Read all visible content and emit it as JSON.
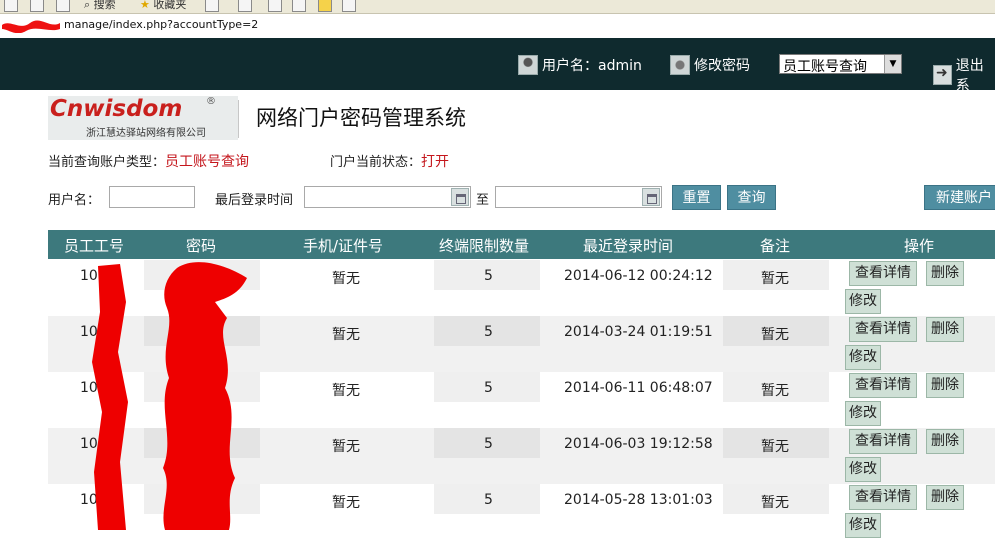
{
  "browser": {
    "toolbar": {
      "search_label": "搜索",
      "favorites_label": "收藏夹"
    },
    "address_url": "manage/index.php?accountType=2"
  },
  "header": {
    "username_label": "用户名：admin",
    "change_password_label": "修改密码",
    "account_select_value": "员工账号查询",
    "logout_label": "退出系"
  },
  "logo": {
    "brand": "Cnwisdom",
    "reg_mark": "®",
    "company": "浙江慧达驿站网络有限公司"
  },
  "page_title": "网络门户密码管理系统",
  "status": {
    "query_type_label": "当前查询账户类型：",
    "query_type_value": "员工账号查询",
    "portal_state_label": "门户当前状态：",
    "portal_state_value": "打开"
  },
  "search": {
    "username_label": "用户名：",
    "last_login_label": "最后登录时间",
    "to_label": "至",
    "reset_button": "重置",
    "query_button": "查询",
    "new_account_button": "新建账户"
  },
  "table": {
    "columns": [
      "员工工号",
      "密码",
      "手机/证件号",
      "终端限制数量",
      "最近登录时间",
      "备注",
      "操作"
    ],
    "detail_button": "查看详情",
    "delete_button": "删除",
    "edit_button": "修改",
    "rows": [
      {
        "id": "10",
        "phone": "暂无",
        "limit": "5",
        "last_login": "2014-06-12 00:24:12",
        "note": "暂无"
      },
      {
        "id": "10",
        "phone": "暂无",
        "limit": "5",
        "last_login": "2014-03-24 01:19:51",
        "note": "暂无"
      },
      {
        "id": "10",
        "phone": "暂无",
        "limit": "5",
        "last_login": "2014-06-11 06:48:07",
        "note": "暂无"
      },
      {
        "id": "10",
        "phone": "暂无",
        "limit": "5",
        "last_login": "2014-06-03 19:12:58",
        "note": "暂无"
      },
      {
        "id": "10",
        "phone": "暂无",
        "limit": "5",
        "last_login": "2014-05-28 13:01:03",
        "note": "暂无"
      }
    ]
  }
}
